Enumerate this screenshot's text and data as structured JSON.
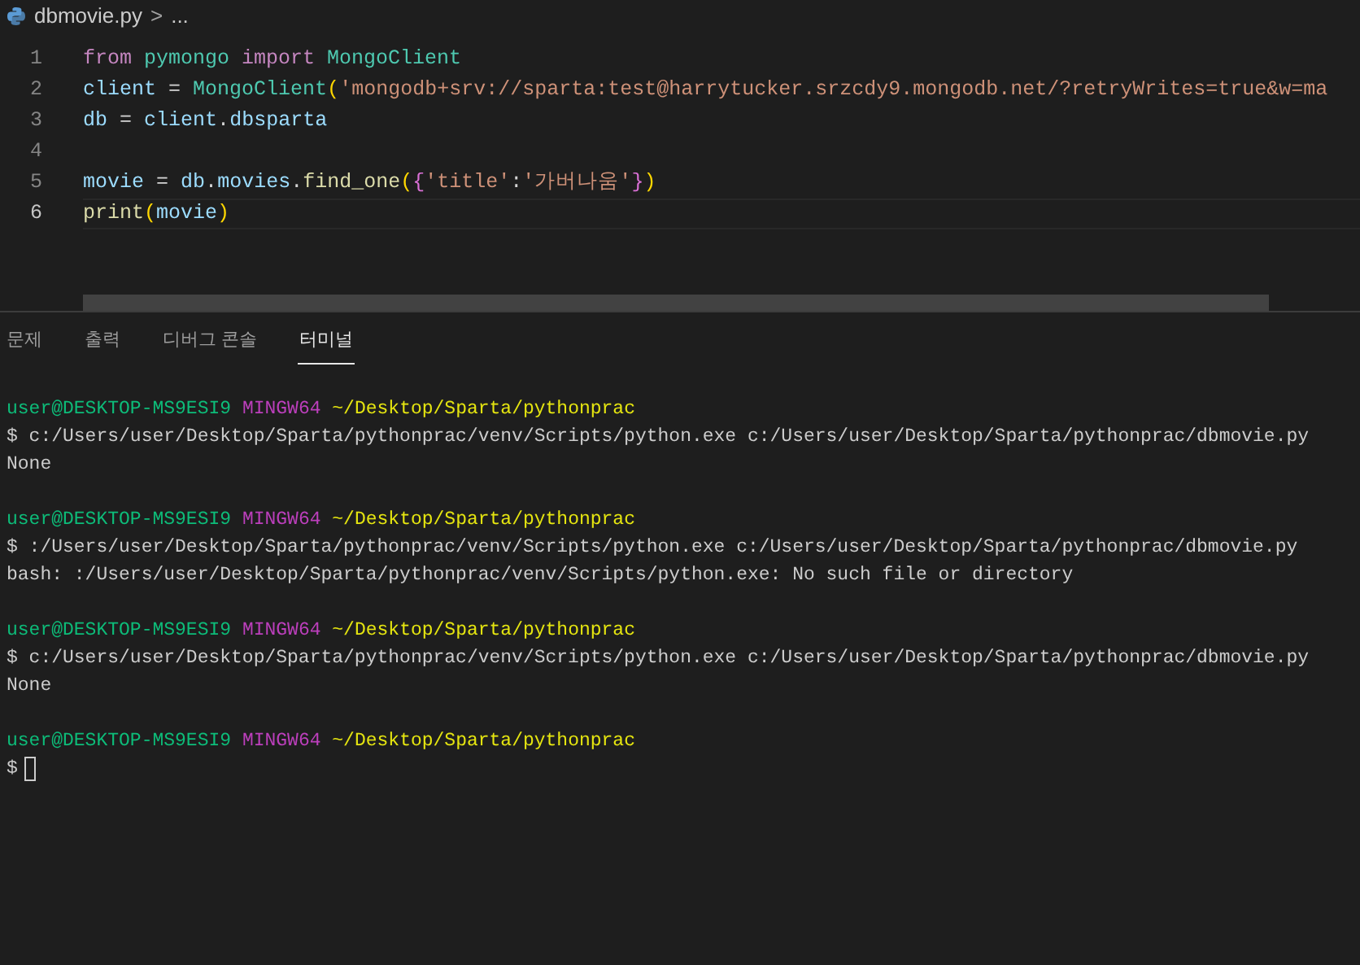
{
  "breadcrumb": {
    "file": "dbmovie.py",
    "separator": ">",
    "more": "..."
  },
  "editor": {
    "lines": [
      {
        "number": "1",
        "active": false,
        "tokens": [
          {
            "kind": "keyword",
            "text": "from "
          },
          {
            "kind": "module",
            "text": "pymongo "
          },
          {
            "kind": "keyword",
            "text": "import "
          },
          {
            "kind": "module",
            "text": "MongoClient"
          }
        ]
      },
      {
        "number": "2",
        "active": false,
        "tokens": [
          {
            "kind": "variable",
            "text": "client"
          },
          {
            "kind": "plain",
            "text": " = "
          },
          {
            "kind": "module",
            "text": "MongoClient"
          },
          {
            "kind": "bracket1",
            "text": "("
          },
          {
            "kind": "string",
            "text": "'mongodb+srv://sparta:test@harrytucker.srzcdy9.mongodb.net/?retryWrites=true&w=ma"
          }
        ]
      },
      {
        "number": "3",
        "active": false,
        "tokens": [
          {
            "kind": "variable",
            "text": "db"
          },
          {
            "kind": "plain",
            "text": " = "
          },
          {
            "kind": "variable",
            "text": "client"
          },
          {
            "kind": "plain",
            "text": "."
          },
          {
            "kind": "variable",
            "text": "dbsparta"
          }
        ]
      },
      {
        "number": "4",
        "active": false
      },
      {
        "number": "5",
        "active": false,
        "tokens": [
          {
            "kind": "variable",
            "text": "movie"
          },
          {
            "kind": "plain",
            "text": " = "
          },
          {
            "kind": "variable",
            "text": "db"
          },
          {
            "kind": "plain",
            "text": "."
          },
          {
            "kind": "variable",
            "text": "movies"
          },
          {
            "kind": "plain",
            "text": "."
          },
          {
            "kind": "function",
            "text": "find_one"
          },
          {
            "kind": "bracket1",
            "text": "("
          },
          {
            "kind": "bracket2",
            "text": "{"
          },
          {
            "kind": "string",
            "text": "'title'"
          },
          {
            "kind": "plain",
            "text": ":"
          },
          {
            "kind": "string",
            "text": "'가버나움'"
          },
          {
            "kind": "bracket2",
            "text": "}"
          },
          {
            "kind": "bracket1",
            "text": ")"
          }
        ]
      },
      {
        "number": "6",
        "active": true,
        "tokens": [
          {
            "kind": "function",
            "text": "print"
          },
          {
            "kind": "bracket1",
            "text": "("
          },
          {
            "kind": "variable",
            "text": "movie"
          },
          {
            "kind": "bracket1",
            "text": ")"
          }
        ]
      }
    ]
  },
  "panel_tabs": [
    {
      "label": "문제",
      "selected": false
    },
    {
      "label": "출력",
      "selected": false
    },
    {
      "label": "디버그 콘솔",
      "selected": false
    },
    {
      "label": "터미널",
      "selected": true
    }
  ],
  "terminal": {
    "sessions": [
      {
        "user": "user@DESKTOP-MS9ESI9",
        "system": "MINGW64",
        "path": "~/Desktop/Sparta/pythonprac",
        "command": "$ c:/Users/user/Desktop/Sparta/pythonprac/venv/Scripts/python.exe c:/Users/user/Desktop/Sparta/pythonprac/dbmovie.py",
        "output": "None",
        "cursor": false
      },
      {
        "user": "user@DESKTOP-MS9ESI9",
        "system": "MINGW64",
        "path": "~/Desktop/Sparta/pythonprac",
        "command": "$ :/Users/user/Desktop/Sparta/pythonprac/venv/Scripts/python.exe c:/Users/user/Desktop/Sparta/pythonprac/dbmovie.py",
        "output": "bash: :/Users/user/Desktop/Sparta/pythonprac/venv/Scripts/python.exe: No such file or directory",
        "cursor": false
      },
      {
        "user": "user@DESKTOP-MS9ESI9",
        "system": "MINGW64",
        "path": "~/Desktop/Sparta/pythonprac",
        "command": "$ c:/Users/user/Desktop/Sparta/pythonprac/venv/Scripts/python.exe c:/Users/user/Desktop/Sparta/pythonprac/dbmovie.py",
        "output": "None",
        "cursor": false
      },
      {
        "user": "user@DESKTOP-MS9ESI9",
        "system": "MINGW64",
        "path": "~/Desktop/Sparta/pythonprac",
        "command": "$",
        "cursor": true
      }
    ]
  }
}
